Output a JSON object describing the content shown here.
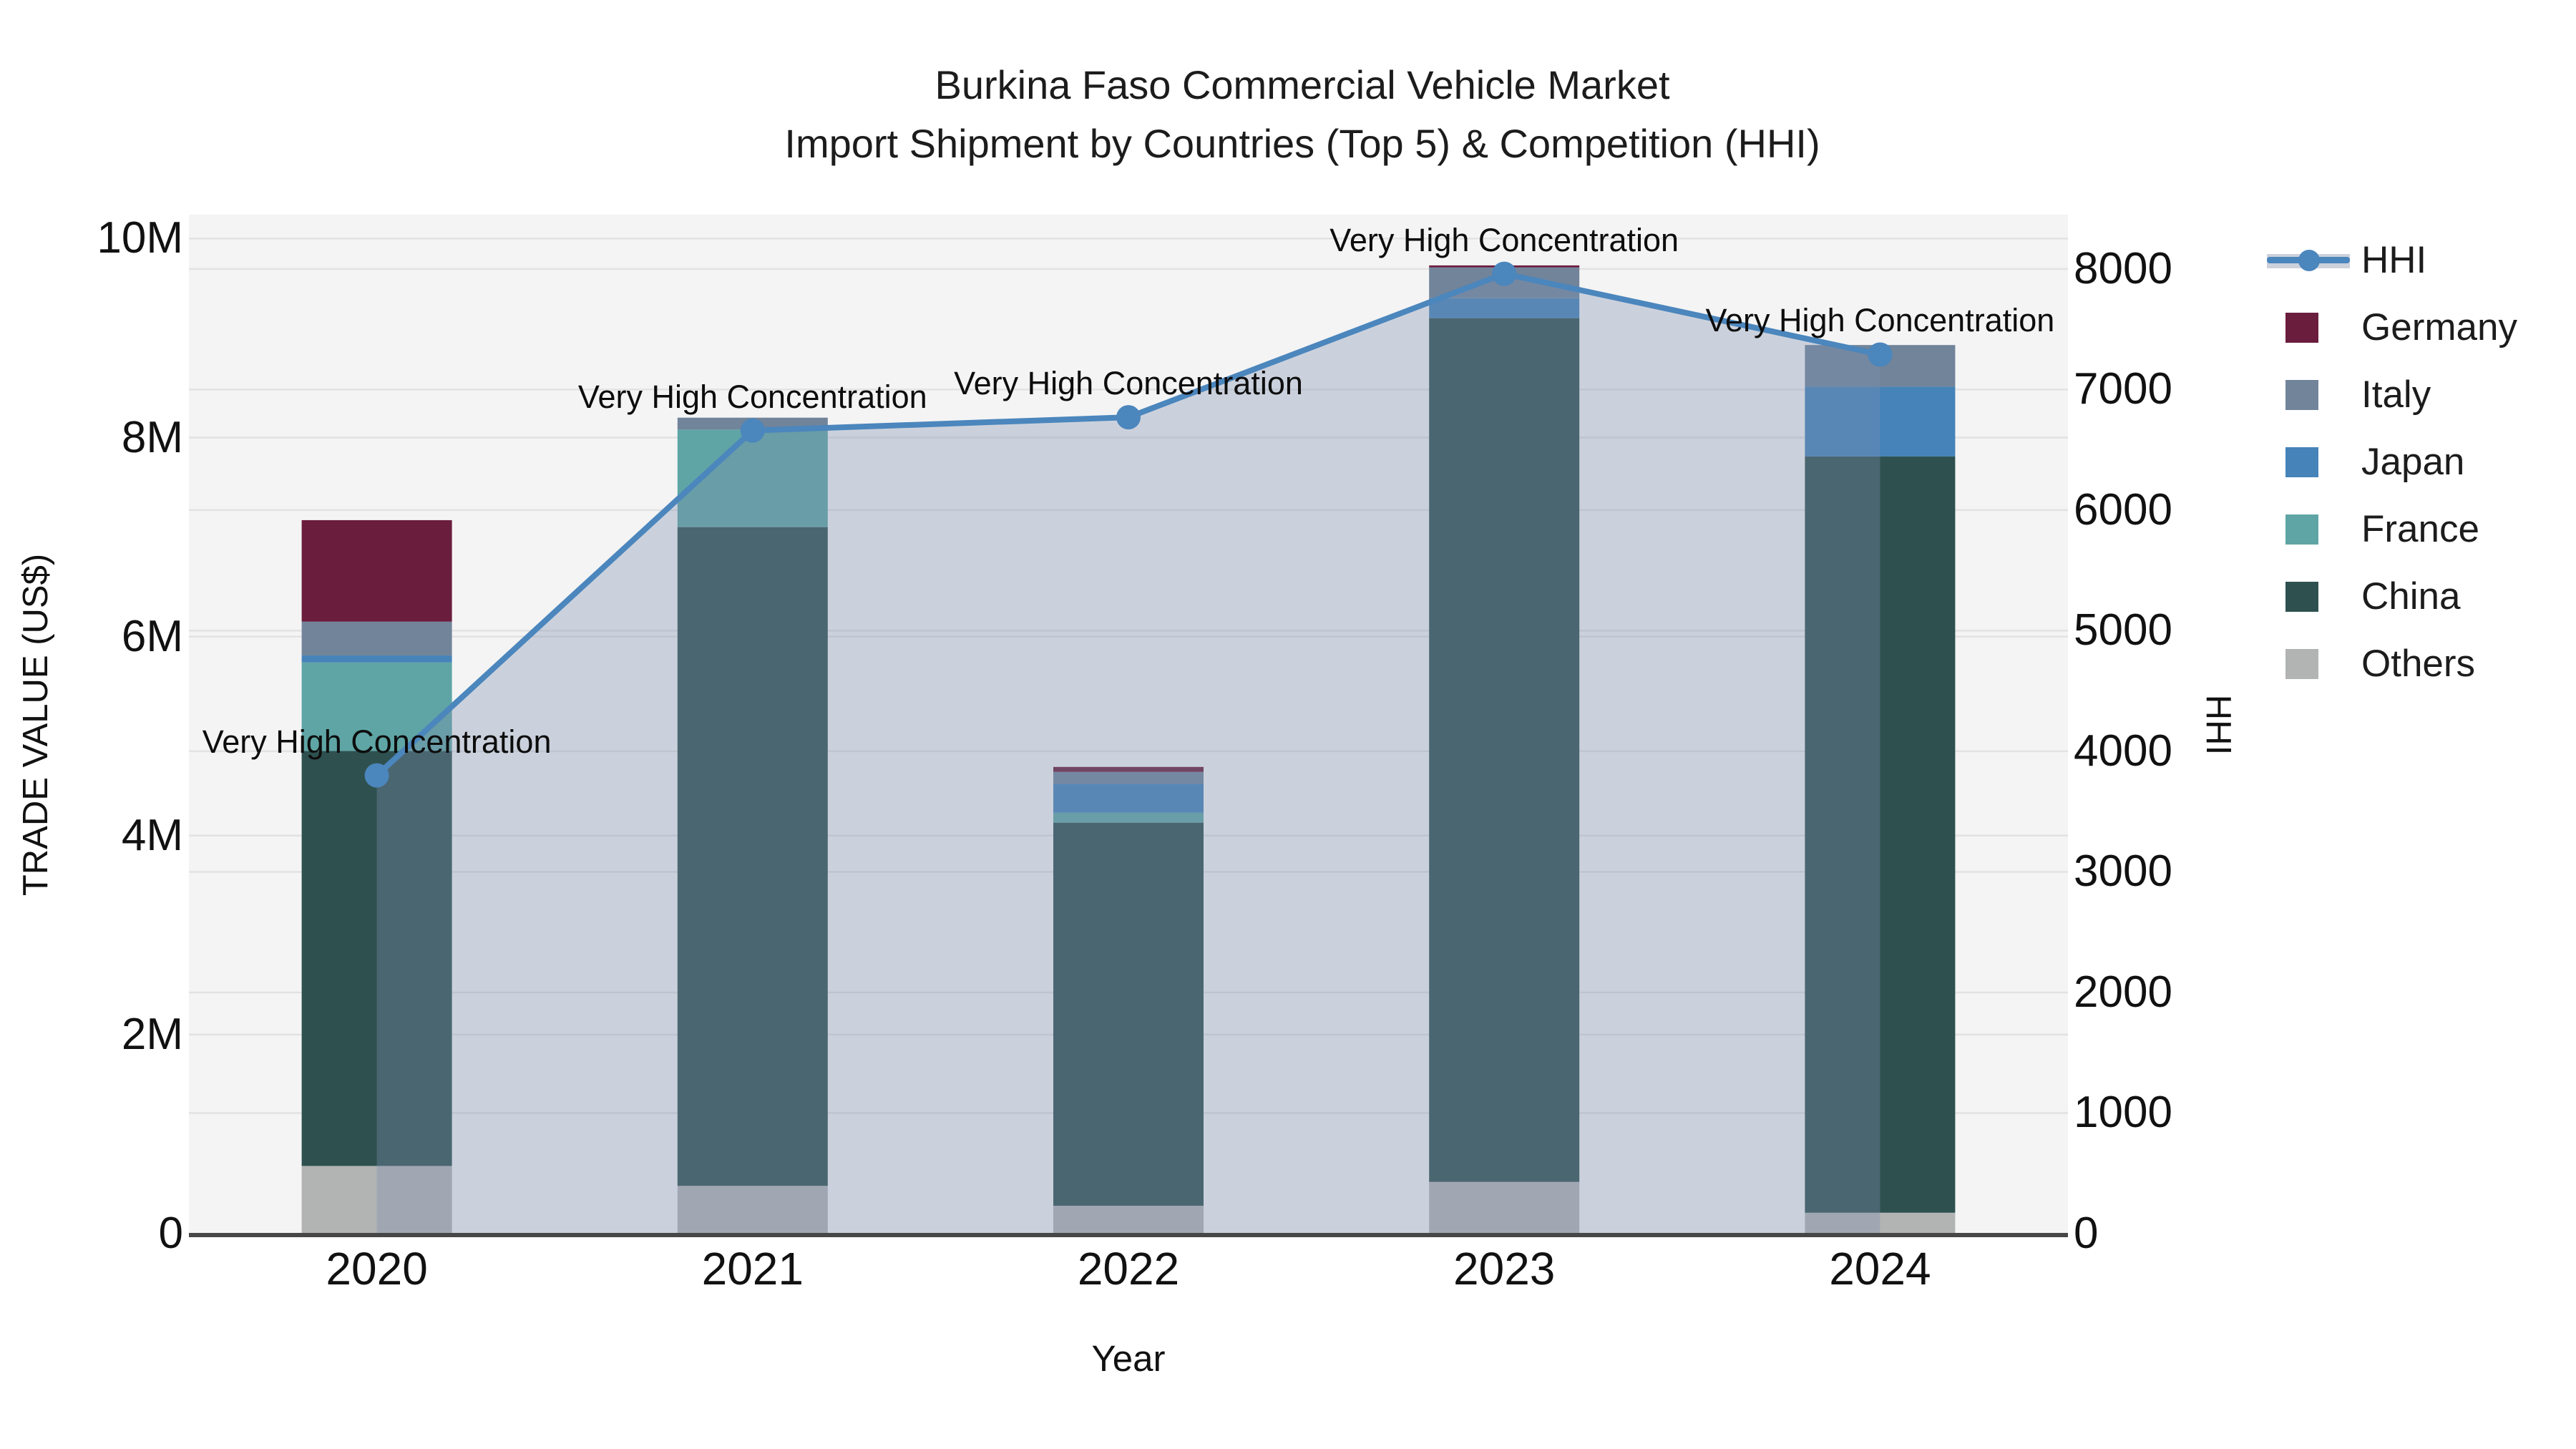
{
  "title": {
    "line1": "Burkina Faso Commercial Vehicle Market",
    "line2": "Import Shipment by Countries (Top 5) & Competition (HHI)"
  },
  "x_axis": {
    "title": "Year",
    "tick_labels": [
      "2020",
      "2021",
      "2022",
      "2023",
      "2024"
    ]
  },
  "y_axis_left": {
    "title": "TRADE VALUE (US$)",
    "tick_labels": [
      "0",
      "2M",
      "4M",
      "6M",
      "8M",
      "10M"
    ],
    "tick_values_musd": [
      0,
      2,
      4,
      6,
      8,
      10
    ]
  },
  "y_axis_right": {
    "title": "HHI",
    "tick_labels": [
      "0",
      "1000",
      "2000",
      "3000",
      "4000",
      "5000",
      "6000",
      "7000",
      "8000"
    ],
    "tick_values": [
      0,
      1000,
      2000,
      3000,
      4000,
      5000,
      6000,
      7000,
      8000
    ]
  },
  "legend": {
    "items": [
      {
        "label": "HHI",
        "type": "line",
        "color": "#4b86bd"
      },
      {
        "label": "Germany",
        "type": "swatch",
        "color": "#6a1d3d"
      },
      {
        "label": "Italy",
        "type": "swatch",
        "color": "#71849a"
      },
      {
        "label": "Japan",
        "type": "swatch",
        "color": "#4583b8"
      },
      {
        "label": "France",
        "type": "swatch",
        "color": "#5fa5a5"
      },
      {
        "label": "China",
        "type": "swatch",
        "color": "#2e5150"
      },
      {
        "label": "Others",
        "type": "swatch",
        "color": "#b2b4b4"
      }
    ]
  },
  "annotations": [
    "Very High Concentration",
    "Very High Concentration",
    "Very High Concentration",
    "Very High Concentration",
    "Very High Concentration"
  ],
  "chart_data": {
    "type": "bar",
    "stacked": true,
    "categories": [
      "2020",
      "2021",
      "2022",
      "2023",
      "2024"
    ],
    "unit": "million US$",
    "series": [
      {
        "name": "Others",
        "color": "#b2b4b4",
        "values": [
          0.68,
          0.48,
          0.28,
          0.52,
          0.21
        ]
      },
      {
        "name": "China",
        "color": "#2e5150",
        "values": [
          4.17,
          6.62,
          3.85,
          8.68,
          7.6
        ]
      },
      {
        "name": "France",
        "color": "#5fa5a5",
        "values": [
          0.89,
          0.98,
          0.1,
          0.0,
          0.0
        ]
      },
      {
        "name": "Japan",
        "color": "#4583b8",
        "values": [
          0.07,
          0.0,
          0.29,
          0.2,
          0.7
        ]
      },
      {
        "name": "Italy",
        "color": "#71849a",
        "values": [
          0.34,
          0.12,
          0.12,
          0.31,
          0.42
        ]
      },
      {
        "name": "Germany",
        "color": "#6a1d3d",
        "values": [
          1.02,
          0.0,
          0.05,
          0.02,
          0.0
        ]
      }
    ],
    "line_overlay": {
      "name": "HHI",
      "axis": "right",
      "color": "#4b86bd",
      "fill_color": "rgba(127,144,176,0.35)",
      "values": [
        3800,
        6660,
        6770,
        7960,
        7290
      ]
    },
    "ylim_left_musd": [
      0,
      10.24
    ],
    "ylim_right_hhi": [
      0,
      8450
    ],
    "gridlines": {
      "left_step_musd": 2,
      "right_step": 1000,
      "color": "#e2e2e2",
      "horizontal_only": true
    },
    "plot_bg": "#f4f4f4",
    "axis_line_color": "#474747",
    "legend_position": "right"
  }
}
